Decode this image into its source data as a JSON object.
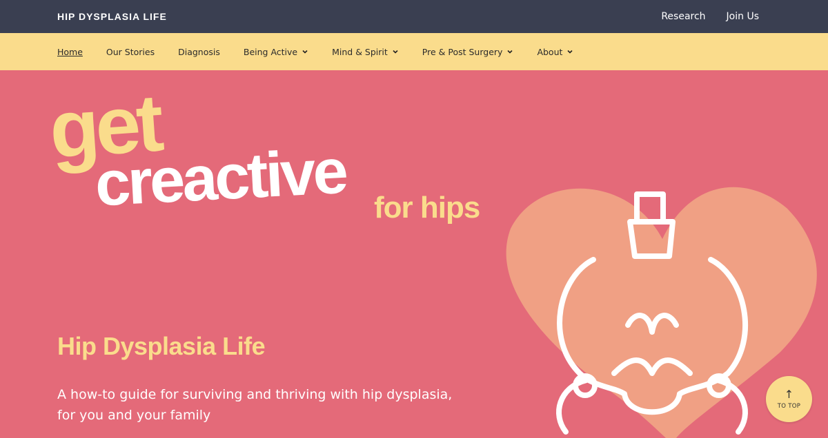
{
  "colors": {
    "top_bar": "#3a3f51",
    "nav_bar": "#fadc8c",
    "hero_bg": "#e46a79",
    "heart": "#f0a084",
    "accent_yellow": "#fadc8c"
  },
  "topbar": {
    "brand": "HIP DYSPLASIA LIFE",
    "links": [
      "Research",
      "Join Us"
    ]
  },
  "nav": {
    "items": [
      {
        "label": "Home",
        "dropdown": false,
        "active": true
      },
      {
        "label": "Our Stories",
        "dropdown": false
      },
      {
        "label": "Diagnosis",
        "dropdown": false
      },
      {
        "label": "Being Active",
        "dropdown": true
      },
      {
        "label": "Mind & Spirit",
        "dropdown": true
      },
      {
        "label": "Pre & Post Surgery",
        "dropdown": true
      },
      {
        "label": "About",
        "dropdown": true
      }
    ]
  },
  "hero": {
    "art_line1": "get",
    "art_line2": "creactive",
    "art_line3": "for hips",
    "heading": "Hip Dysplasia Life",
    "subheading": "A how-to guide for surviving and thriving with hip dysplasia, for you and your family",
    "illustration_icon": "pelvis-heart-icon"
  },
  "to_top": {
    "arrow": "↑",
    "label": "TO TOP"
  }
}
